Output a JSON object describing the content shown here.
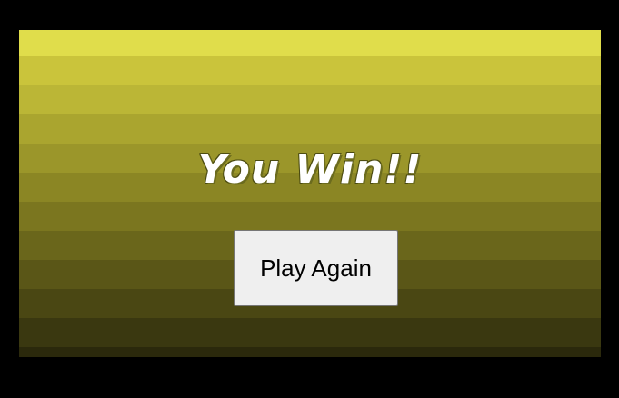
{
  "game": {
    "result_title": "You Win!!",
    "play_again_label": "Play Again"
  }
}
